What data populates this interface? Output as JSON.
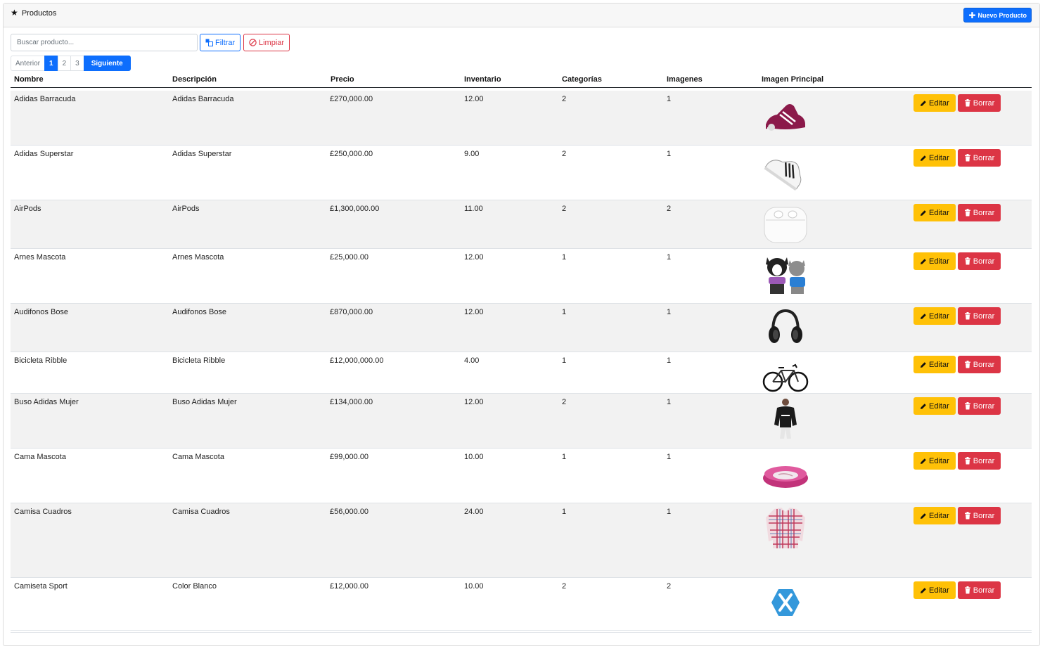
{
  "header": {
    "star_icon": "★",
    "title": "Productos",
    "new_button_label": "Nuevo Producto"
  },
  "search": {
    "placeholder": "Buscar producto...",
    "value": ""
  },
  "filter_label": "Filtrar",
  "clear_label": "Limpiar",
  "pagination": {
    "prev": "Anterior",
    "pages": [
      "1",
      "2",
      "3"
    ],
    "active_page": "1",
    "next": "Siguiente"
  },
  "columns": [
    "Nombre",
    "Descripción",
    "Precio",
    "Inventario",
    "Categorías",
    "Imagenes",
    "Imagen Principal"
  ],
  "actions": {
    "edit": "Editar",
    "delete": "Borrar"
  },
  "colors": {
    "primary": "#0d6efd",
    "warning": "#ffc107",
    "danger": "#dc3545"
  },
  "rows": [
    {
      "nombre": "Adidas Barracuda",
      "descripcion": "Adidas Barracuda",
      "precio": "£270,000.00",
      "inventario": "12.00",
      "categorias": "2",
      "imagenes": "1",
      "image_icon": "sneaker-maroon-icon"
    },
    {
      "nombre": "Adidas Superstar",
      "descripcion": "Adidas Superstar",
      "precio": "£250,000.00",
      "inventario": "9.00",
      "categorias": "2",
      "imagenes": "1",
      "image_icon": "sneaker-white-icon"
    },
    {
      "nombre": "AirPods",
      "descripcion": "AirPods",
      "precio": "£1,300,000.00",
      "inventario": "11.00",
      "categorias": "2",
      "imagenes": "2",
      "image_icon": "airpods-case-icon"
    },
    {
      "nombre": "Arnes Mascota",
      "descripcion": "Arnes Mascota",
      "precio": "£25,000.00",
      "inventario": "12.00",
      "categorias": "1",
      "imagenes": "1",
      "image_icon": "pets-harness-icon"
    },
    {
      "nombre": "Audifonos Bose",
      "descripcion": "Audifonos Bose",
      "precio": "£870,000.00",
      "inventario": "12.00",
      "categorias": "1",
      "imagenes": "1",
      "image_icon": "headphones-icon"
    },
    {
      "nombre": "Bicicleta Ribble",
      "descripcion": "Bicicleta Ribble",
      "precio": "£12,000,000.00",
      "inventario": "4.00",
      "categorias": "1",
      "imagenes": "1",
      "image_icon": "bicycle-icon"
    },
    {
      "nombre": "Buso Adidas Mujer",
      "descripcion": "Buso Adidas Mujer",
      "precio": "£134,000.00",
      "inventario": "12.00",
      "categorias": "2",
      "imagenes": "1",
      "image_icon": "sweatshirt-model-icon"
    },
    {
      "nombre": "Cama Mascota",
      "descripcion": "Cama Mascota",
      "precio": "£99,000.00",
      "inventario": "10.00",
      "categorias": "1",
      "imagenes": "1",
      "image_icon": "pet-bed-icon"
    },
    {
      "nombre": "Camisa Cuadros",
      "descripcion": "Camisa Cuadros",
      "precio": "£56,000.00",
      "inventario": "24.00",
      "categorias": "1",
      "imagenes": "1",
      "image_icon": "plaid-shirt-icon"
    },
    {
      "nombre": "Camiseta Sport",
      "descripcion": "Color Blanco",
      "precio": "£12,000.00",
      "inventario": "10.00",
      "categorias": "2",
      "imagenes": "2",
      "image_icon": "xamarin-logo-icon"
    }
  ]
}
